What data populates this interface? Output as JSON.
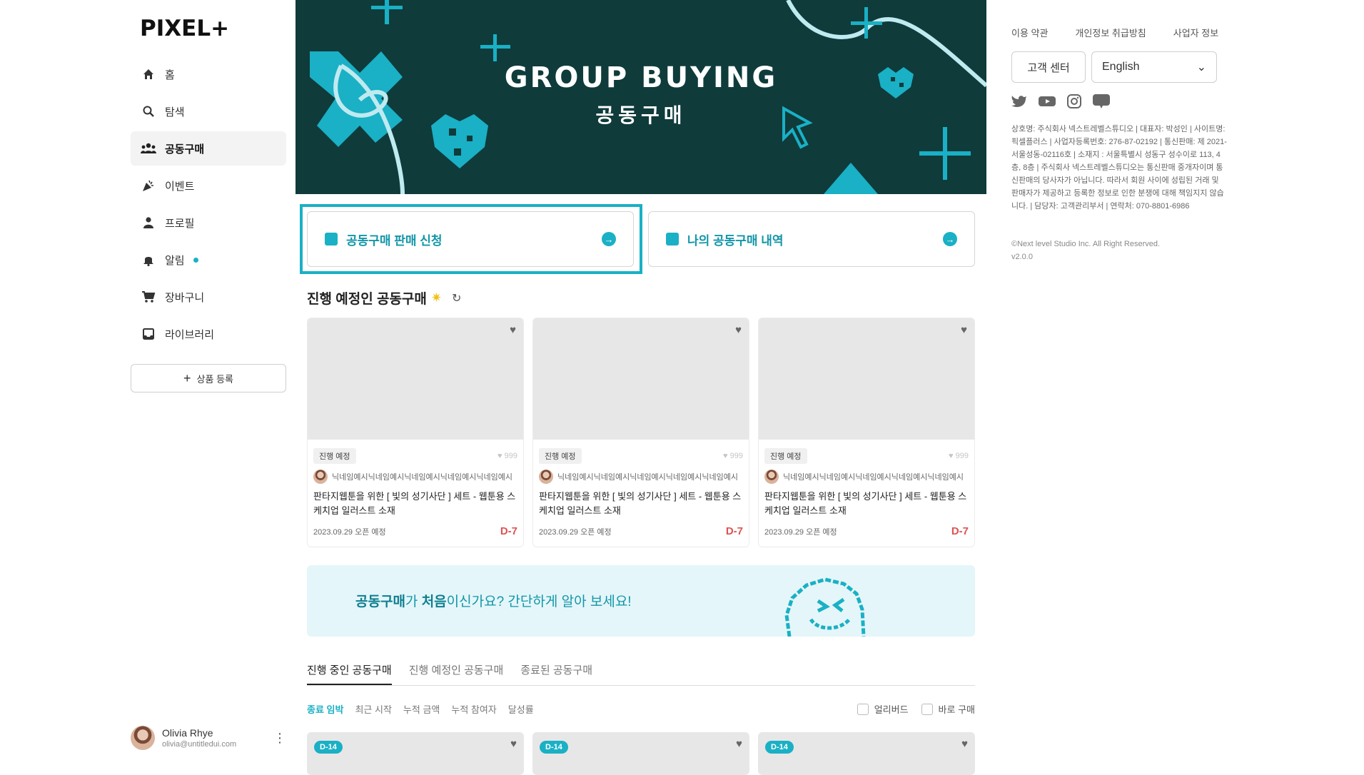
{
  "brand": {
    "logo": "PIXEL+",
    "accent": "#1ab0c5",
    "banner_bg": "#0f3b3b",
    "dday_color": "#e05252"
  },
  "sidebar": {
    "items": [
      {
        "label": "홈",
        "icon": "home-icon"
      },
      {
        "label": "탐색",
        "icon": "search-icon"
      },
      {
        "label": "공동구매",
        "icon": "group-icon",
        "active": true
      },
      {
        "label": "이벤트",
        "icon": "party-icon"
      },
      {
        "label": "프로필",
        "icon": "person-icon"
      },
      {
        "label": "알림",
        "icon": "bell-icon",
        "dot": true
      },
      {
        "label": "장바구니",
        "icon": "cart-icon"
      },
      {
        "label": "라이브러리",
        "icon": "library-icon"
      }
    ],
    "register_button": "상품 등록",
    "user": {
      "name": "Olivia Rhye",
      "email": "olivia@untitledui.com"
    }
  },
  "banner": {
    "title": "GROUP BUYING",
    "subtitle": "공동구매"
  },
  "actions": {
    "apply": "공동구매 판매 신청",
    "history": "나의 공동구매 내역"
  },
  "upcoming": {
    "title": "진행 예정인 공동구매",
    "cards": [
      {
        "status": "진행 예정",
        "likes": "999",
        "seller": "닉네임예시닉네임예시닉네임예시닉네임예시닉네임예시",
        "title": "판타지웹툰을 위한 [ 빛의 성기사단 ] 세트 - 웹툰용 스케치업 일러스트 소재",
        "date": "2023.09.29 오픈 예정",
        "dday": "D-7"
      },
      {
        "status": "진행 예정",
        "likes": "999",
        "seller": "닉네임예시닉네임예시닉네임예시닉네임예시닉네임예시",
        "title": "판타지웹툰을 위한 [ 빛의 성기사단 ] 세트 - 웹툰용 스케치업 일러스트 소재",
        "date": "2023.09.29 오픈 예정",
        "dday": "D-7"
      },
      {
        "status": "진행 예정",
        "likes": "999",
        "seller": "닉네임예시닉네임예시닉네임예시닉네임예시닉네임예시",
        "title": "판타지웹툰을 위한 [ 빛의 성기사단 ] 세트 - 웹툰용 스케치업 일러스트 소재",
        "date": "2023.09.29 오픈 예정",
        "dday": "D-7"
      }
    ]
  },
  "guide": {
    "part1": "공동구매",
    "part2": "가 ",
    "part3": "처음",
    "part4": "이신가요? 간단하게 알아 보세요!"
  },
  "tabs": [
    "진행 중인 공동구매",
    "진행 예정인 공동구매",
    "종료된 공동구매"
  ],
  "sorts": [
    "종료 임박",
    "최근 시작",
    "누적 금액",
    "누적 참여자",
    "달성률"
  ],
  "checkboxes": [
    "얼리버드",
    "바로 구매"
  ],
  "bottom_cards": [
    {
      "dday": "D-14"
    },
    {
      "dday": "D-14"
    },
    {
      "dday": "D-14"
    }
  ],
  "right": {
    "links": [
      "이용 약관",
      "개인정보 취급방침",
      "사업자 정보"
    ],
    "cs_button": "고객 센터",
    "language": "English",
    "social": [
      "twitter-icon",
      "youtube-icon",
      "instagram-icon",
      "blog-icon"
    ],
    "company_info": "상호명: 주식회사 넥스트레벨스튜디오 | 대표자: 박성인 | 사이트명: 픽셀플러스 | 사업자등록번호: 276-87-02192 | 통신판매: 제 2021-서울성동-02116호 | 소재지 : 서울특별시 성동구 성수이로 113, 4층, 8층 | 주식회사 넥스트레벨스튜디오는 통신판매 중개자이며 통신판매의 당사자가 아닙니다. 따라서 회원 사이에 성립된 거래 및 판매자가 제공하고 등록한 정보로 인한 분쟁에 대해 책임지지 않습니다. | 담당자: 고객관리부서 | 연락처: 070-8801-6986",
    "copyright": "©Next level Studio Inc. All Right Reserved.",
    "version": "v2.0.0"
  }
}
